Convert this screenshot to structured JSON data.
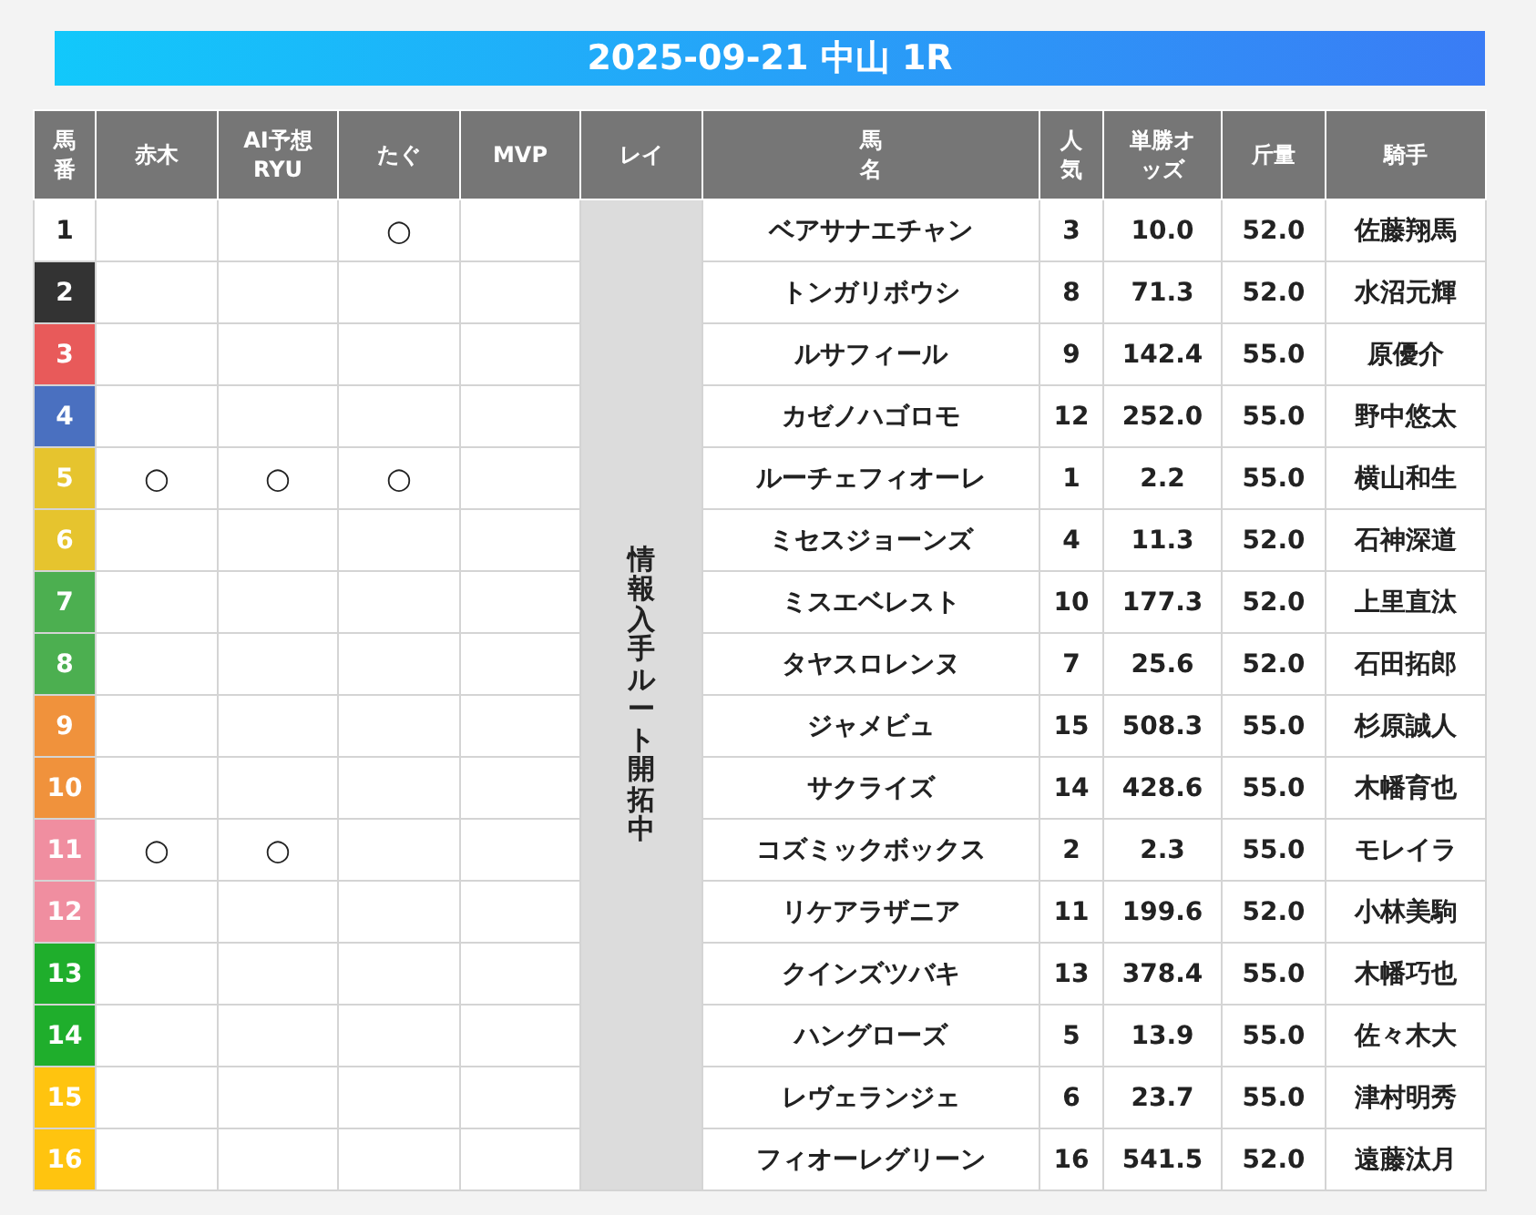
{
  "title": "2025-09-21 中山 1R",
  "columns": [
    "馬番",
    "赤木",
    "AI予想\nRYU",
    "たぐ",
    "MVP",
    "レイ",
    "馬名",
    "人気",
    "単勝オッズ",
    "斤量",
    "騎手"
  ],
  "rei_note": "情報入手ルート開拓中",
  "rows": [
    {
      "number": "1",
      "color": "#ffffff",
      "marks": {
        "tagu": "○"
      },
      "name": "ベアサナエチャン",
      "popularity": "3",
      "odds": "10.0",
      "weight": "52.0",
      "jockey": "佐藤翔馬"
    },
    {
      "number": "2",
      "color": "#333333",
      "name": "トンガリボウシ",
      "popularity": "8",
      "odds": "71.3",
      "weight": "52.0",
      "jockey": "水沼元輝"
    },
    {
      "number": "3",
      "color": "#e85a5a",
      "name": "ルサフィール",
      "popularity": "9",
      "odds": "142.4",
      "weight": "55.0",
      "jockey": "原優介"
    },
    {
      "number": "4",
      "color": "#4a70c0",
      "name": "カゼノハゴロモ",
      "popularity": "12",
      "odds": "252.0",
      "weight": "55.0",
      "jockey": "野中悠太"
    },
    {
      "number": "5",
      "color": "#e6c42e",
      "marks": {
        "akagi": "○",
        "ai": "○",
        "tagu": "○"
      },
      "name": "ルーチェフィオーレ",
      "popularity": "1",
      "odds": "2.2",
      "weight": "55.0",
      "jockey": "横山和生"
    },
    {
      "number": "6",
      "color": "#e6c42e",
      "name": "ミセスジョーンズ",
      "popularity": "4",
      "odds": "11.3",
      "weight": "52.0",
      "jockey": "石神深道"
    },
    {
      "number": "7",
      "color": "#4caf50",
      "name": "ミスエベレスト",
      "popularity": "10",
      "odds": "177.3",
      "weight": "52.0",
      "jockey": "上里直汰"
    },
    {
      "number": "8",
      "color": "#4caf50",
      "name": "タヤスロレンヌ",
      "popularity": "7",
      "odds": "25.6",
      "weight": "52.0",
      "jockey": "石田拓郎"
    },
    {
      "number": "9",
      "color": "#f0923c",
      "name": "ジャメビュ",
      "popularity": "15",
      "odds": "508.3",
      "weight": "55.0",
      "jockey": "杉原誠人"
    },
    {
      "number": "10",
      "color": "#f0923c",
      "name": "サクライズ",
      "popularity": "14",
      "odds": "428.6",
      "weight": "55.0",
      "jockey": "木幡育也"
    },
    {
      "number": "11",
      "color": "#f08ea0",
      "marks": {
        "akagi": "○",
        "ai": "○"
      },
      "name": "コズミックボックス",
      "popularity": "2",
      "odds": "2.3",
      "weight": "55.0",
      "jockey": "モレイラ"
    },
    {
      "number": "12",
      "color": "#f08ea0",
      "name": "リケアラザニア",
      "popularity": "11",
      "odds": "199.6",
      "weight": "52.0",
      "jockey": "小林美駒"
    },
    {
      "number": "13",
      "color": "#1fae2c",
      "name": "クインズツバキ",
      "popularity": "13",
      "odds": "378.4",
      "weight": "55.0",
      "jockey": "木幡巧也"
    },
    {
      "number": "14",
      "color": "#1fae2c",
      "name": "ハングローズ",
      "popularity": "5",
      "odds": "13.9",
      "weight": "55.0",
      "jockey": "佐々木大"
    },
    {
      "number": "15",
      "color": "#ffc40f",
      "name": "レヴェランジェ",
      "popularity": "6",
      "odds": "23.7",
      "weight": "55.0",
      "jockey": "津村明秀"
    },
    {
      "number": "16",
      "color": "#ffc40f",
      "name": "フィオーレグリーン",
      "popularity": "16",
      "odds": "541.5",
      "weight": "52.0",
      "jockey": "遠藤汰月"
    }
  ]
}
